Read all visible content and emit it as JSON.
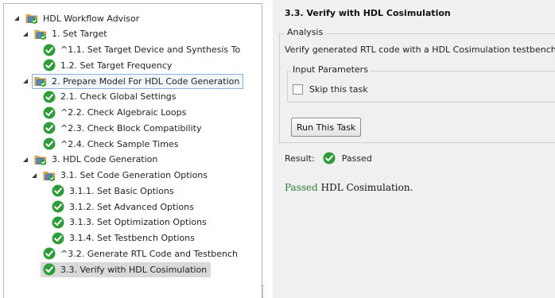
{
  "tree": [
    {
      "label": "HDL Workflow Advisor",
      "depth": 0,
      "icon": "advisor-folder-icon",
      "expanded": true
    },
    {
      "label": "1. Set Target",
      "depth": 1,
      "icon": "advisor-folder-icon",
      "expanded": true
    },
    {
      "label": "^1.1. Set Target Device and Synthesis To",
      "depth": 2,
      "icon": "check-pass-icon"
    },
    {
      "label": "1.2. Set Target Frequency",
      "depth": 2,
      "icon": "check-pass-icon"
    },
    {
      "label": "2. Prepare Model For HDL Code Generation",
      "depth": 1,
      "icon": "advisor-folder-icon",
      "expanded": true,
      "boxed": true
    },
    {
      "label": "2.1. Check Global Settings",
      "depth": 2,
      "icon": "check-pass-icon"
    },
    {
      "label": "^2.2. Check Algebraic Loops",
      "depth": 2,
      "icon": "check-pass-icon"
    },
    {
      "label": "^2.3. Check Block Compatibility",
      "depth": 2,
      "icon": "check-pass-icon"
    },
    {
      "label": "^2.4. Check Sample Times",
      "depth": 2,
      "icon": "check-pass-icon"
    },
    {
      "label": "3. HDL Code Generation",
      "depth": 1,
      "icon": "advisor-folder-icon",
      "expanded": true
    },
    {
      "label": "3.1. Set Code Generation Options",
      "depth": 2,
      "icon": "advisor-folder-icon",
      "expanded": true
    },
    {
      "label": "3.1.1. Set Basic Options",
      "depth": 3,
      "icon": "check-pass-icon"
    },
    {
      "label": "3.1.2. Set Advanced Options",
      "depth": 3,
      "icon": "check-pass-icon"
    },
    {
      "label": "3.1.3. Set Optimization Options",
      "depth": 3,
      "icon": "check-pass-icon"
    },
    {
      "label": "3.1.4. Set Testbench Options",
      "depth": 3,
      "icon": "check-pass-icon"
    },
    {
      "label": "^3.2. Generate RTL Code and Testbench",
      "depth": 2,
      "icon": "check-pass-icon"
    },
    {
      "label": "3.3. Verify with HDL Cosimulation",
      "depth": 2,
      "icon": "check-pass-icon",
      "active": true
    }
  ],
  "task": {
    "title": "3.3. Verify with HDL Cosimulation",
    "analysis_legend": "Analysis",
    "description": "Verify generated RTL code with a HDL Cosimulation testbench",
    "input_legend": "Input Parameters",
    "skip_label": "Skip this task",
    "run_label": "Run This Task",
    "result_label": "Result:",
    "result_value": "Passed",
    "result_msg_status": "Passed",
    "result_msg_text": " HDL Cosimulation."
  },
  "colors": {
    "pass_green": "#2e9d39",
    "selection_gray": "#d9d9d9",
    "panel_bg": "#f0f0f0"
  }
}
